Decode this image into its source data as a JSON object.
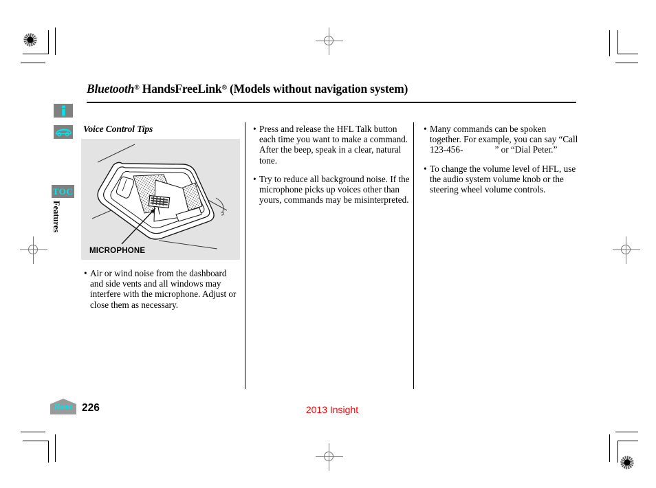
{
  "document": {
    "title_parts": {
      "brand": "Bluetooth",
      "brand_sup": "®",
      "product": " HandsFreeLink",
      "product_sup": "®",
      "qualifier": " (Models without navigation system)"
    },
    "title_plain": "Bluetooth® HandsFreeLink® (Models without navigation system)"
  },
  "sidebar": {
    "info_icon": "info-icon",
    "vehicle_icon": "vehicle-icon",
    "toc_label": "TOC",
    "section_tab_label": "Features"
  },
  "left_column": {
    "heading": "Voice Control Tips",
    "figure": {
      "caption": "MICROPHONE",
      "description": "overhead-console-microphone-illustration"
    },
    "bullets": [
      {
        "marker": "•",
        "text": "Air or wind noise from the dashboard and side vents and all windows may interfere with the microphone. Adjust or close them as necessary."
      }
    ]
  },
  "middle_column": {
    "bullets": [
      {
        "marker": "•",
        "text": "Press and release the HFL Talk button each time you want to make a command. After the beep, speak in a clear, natural tone."
      },
      {
        "marker": "•",
        "text": "Try to reduce all background noise. If the microphone picks up voices other than yours, commands may be misinterpreted."
      }
    ]
  },
  "right_column": {
    "bullets": [
      {
        "marker": "•",
        "text": "Many commands can be spoken together. For example, you can say “Call 123-456-              ” or “Dial Peter.”"
      },
      {
        "marker": "•",
        "text": "To change the volume level of HFL, use the audio system volume knob or the steering wheel volume controls."
      }
    ]
  },
  "footer": {
    "home_label": "Home",
    "page_number": "226",
    "model_year_name": "2013 Insight"
  },
  "colors": {
    "accent_cyan": "#00e5ee",
    "tab_gray": "#808080",
    "figure_bg": "#e3e3e3",
    "model_red": "#ff0000"
  }
}
